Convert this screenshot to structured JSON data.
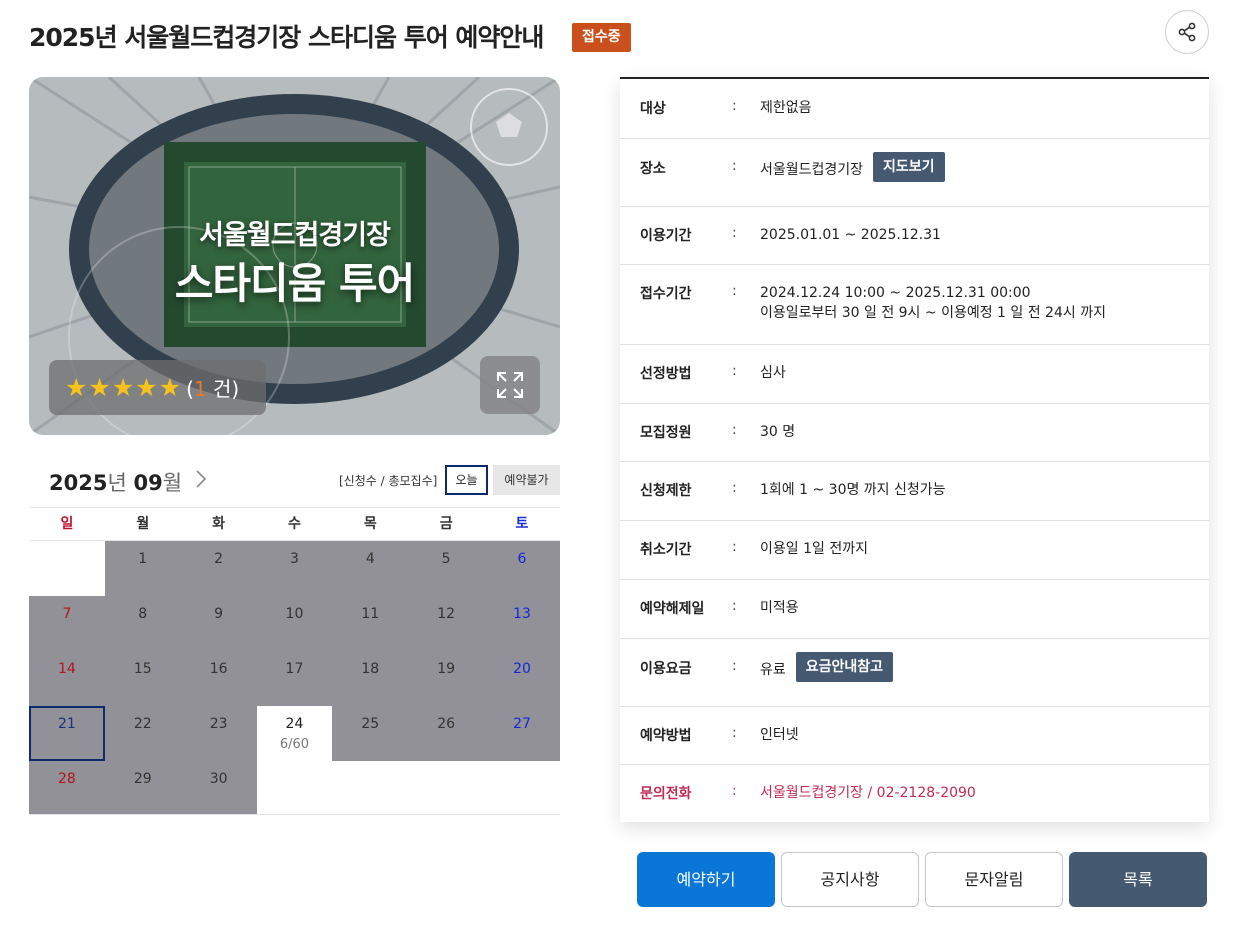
{
  "header": {
    "title": "2025년 서울월드컵경기장 스타디움 투어 예약안내",
    "status": "접수중"
  },
  "hero": {
    "title_line1": "서울월드컵경기장",
    "title_line2": "스타디움 투어",
    "stars": "★★★★★",
    "rating_open": "(",
    "rating_count": "1",
    "rating_unit": " 건)"
  },
  "calendar": {
    "year": "2025",
    "year_unit": "년 ",
    "month": "09",
    "month_unit": "월",
    "legend": "[신청수 / 총모집수]",
    "today_label": "오늘",
    "unavailable_label": "예약불가",
    "weekdays": [
      "일",
      "월",
      "화",
      "수",
      "목",
      "금",
      "토"
    ],
    "days": [
      "1",
      "2",
      "3",
      "4",
      "5",
      "6",
      "7",
      "8",
      "9",
      "10",
      "11",
      "12",
      "13",
      "14",
      "15",
      "16",
      "17",
      "18",
      "19",
      "20",
      "21",
      "22",
      "23",
      "24",
      "25",
      "26",
      "27",
      "28",
      "29",
      "30"
    ],
    "day24_count": "6/60"
  },
  "info": {
    "target_label": "대상",
    "target_value": "제한없음",
    "place_label": "장소",
    "place_value": "서울월드컵경기장",
    "map_button": "지도보기",
    "use_period_label": "이용기간",
    "use_period_value": "2025.01.01 ~ 2025.12.31",
    "apply_period_label": "접수기간",
    "apply_period_value1": "2024.12.24 10:00 ~ 2025.12.31 00:00",
    "apply_period_value2": "이용일로부터 30 일 전 9시 ~ 이용예정 1 일 전 24시 까지",
    "selection_label": "선정방법",
    "selection_value": "심사",
    "capacity_label": "모집정원",
    "capacity_value": "30 명",
    "limit_label": "신청제한",
    "limit_value": "1회에 1 ~ 30명 까지 신청가능",
    "cancel_label": "취소기간",
    "cancel_value": "이용일 1일 전까지",
    "release_label": "예약해제일",
    "release_value": "미적용",
    "fee_label": "이용요금",
    "fee_value": "유료",
    "fee_button": "요금안내참고",
    "method_label": "예약방법",
    "method_value": "인터넷",
    "phone_label": "문의전화",
    "phone_value": "서울월드컵경기장 / 02-2128-2090",
    "colon": ":"
  },
  "buttons": {
    "reserve": "예약하기",
    "notice": "공지사항",
    "sms": "문자알림",
    "list": "목록"
  },
  "colors": {
    "status_badge": "#c9501d",
    "primary": "#0a77d8",
    "dark_button": "#455a71",
    "unavailable_cell": "#919197",
    "phone": "#c22b55"
  }
}
